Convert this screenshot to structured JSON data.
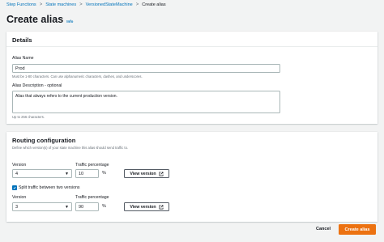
{
  "breadcrumb": {
    "items": [
      "Step Functions",
      "State machines",
      "VersionedStateMachine"
    ],
    "current": "Create alias",
    "separator": ">"
  },
  "page": {
    "title": "Create alias",
    "info_link": "Info"
  },
  "details": {
    "title": "Details",
    "alias_name": {
      "label": "Alias Name",
      "value": "Prod",
      "hint": "Must be 1-80 characters. Can use alphanumeric characters, dashes, and underscores."
    },
    "alias_description": {
      "label": "Alias Description - optional",
      "value": "Alias that always refers to the current production version.",
      "hint": "Up to 256 characters."
    }
  },
  "routing": {
    "title": "Routing configuration",
    "subtitle": "Define which version(s) of your state machine this alias should send traffic to.",
    "version_label": "Version",
    "traffic_label": "Traffic percentage",
    "percent_sign": "%",
    "view_version_label": "View version",
    "rows": [
      {
        "version": "4",
        "traffic": "10"
      },
      {
        "version": "3",
        "traffic": "90"
      }
    ],
    "split_checkbox": {
      "label": "Split traffic between two versions",
      "checked": true
    }
  },
  "footer": {
    "cancel": "Cancel",
    "create": "Create alias"
  },
  "colors": {
    "link": "#0073bb",
    "primary": "#ec7211",
    "checkbox": "#0073bb"
  },
  "icons": {
    "external_link": "external-link-icon",
    "dropdown": "caret-down-icon",
    "check": "check-icon"
  }
}
